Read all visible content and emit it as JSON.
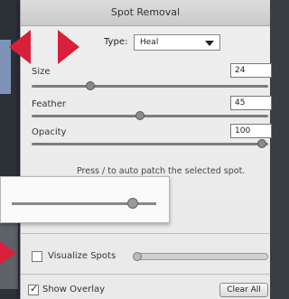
{
  "panel": {
    "title": "Spot Removal",
    "type_label": "Type:",
    "type_value": "Heal",
    "size_label": "Size",
    "size_value": "24",
    "feather_label": "Feather",
    "feather_value": "45",
    "opacity_label": "Opacity",
    "opacity_value": "100",
    "hint": "Press / to auto patch the selected spot.",
    "visualize_label": "Visualize Spots",
    "show_overlay_label": "Show Overlay",
    "clear_all_label": "Clear All"
  },
  "colors": {
    "accent_arrow": "#d8203a"
  }
}
